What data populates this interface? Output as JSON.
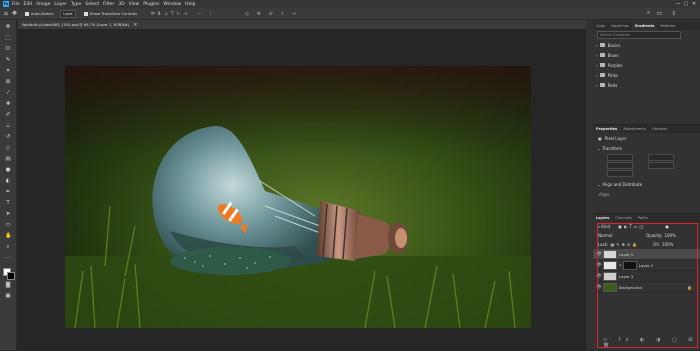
{
  "app": {
    "logo_text": "Ps"
  },
  "menu": [
    "File",
    "Edit",
    "Image",
    "Layer",
    "Type",
    "Select",
    "Filter",
    "3D",
    "View",
    "Plugins",
    "Window",
    "Help"
  ],
  "window_controls": [
    "—",
    "▢",
    "✕"
  ],
  "options_bar": {
    "auto_select_label": "Auto-Select:",
    "auto_select_value": "Layer",
    "show_transform_label": "Show Transform Controls"
  },
  "document_tab": {
    "title": "lightbulb-p1dae4465_1920.psd @ 66.7% (Layer 1, RGB/8#)",
    "close": "×"
  },
  "gradients_panel": {
    "tabs": [
      "Color",
      "Swatches",
      "Gradients",
      "Patterns"
    ],
    "active_tab": "Gradients",
    "search_placeholder": "Search Gradients",
    "folders": [
      "Basics",
      "Blues",
      "Purples",
      "Pinks",
      "Reds"
    ]
  },
  "properties_panel": {
    "tabs": [
      "Properties",
      "Adjustments",
      "Libraries"
    ],
    "active_tab": "Properties",
    "layer_type": "Pixel Layer",
    "transform_label": "Transform",
    "align_label": "Align and Distribute",
    "align_sub": "Align:"
  },
  "layers_panel": {
    "tabs": [
      "Layers",
      "Channels",
      "Paths"
    ],
    "active_tab": "Layers",
    "filter_kind": "Kind",
    "blend_mode": "Normal",
    "opacity_label": "Opacity:",
    "opacity_value": "100%",
    "lock_label": "Lock:",
    "fill_label": "Fill:",
    "fill_value": "100%",
    "layers": [
      {
        "name": "Layer 1",
        "selected": true
      },
      {
        "name": "Layer 2",
        "selected": false
      },
      {
        "name": "Layer 3",
        "selected": false
      },
      {
        "name": "Background",
        "selected": false,
        "locked": true
      }
    ]
  },
  "colors": {
    "highlight": "#e0202a",
    "accent": "#31a8ff"
  }
}
